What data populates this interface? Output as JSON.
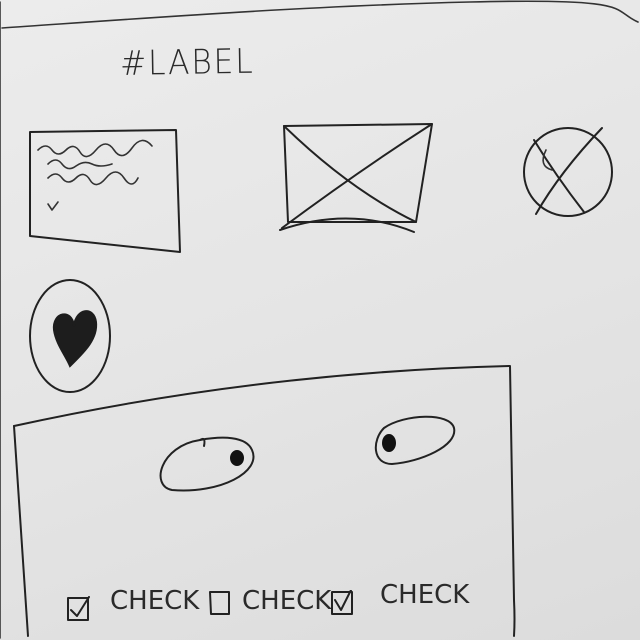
{
  "header": {
    "label": "#LABEL"
  },
  "icons": {
    "text_block": "text-paragraph-icon",
    "image_placeholder": "image-placeholder-icon",
    "close_circle": "close-circle-icon",
    "heart_button": "heart-icon"
  },
  "panel": {
    "eyes": [
      "eye-icon",
      "eye-icon"
    ]
  },
  "checkboxes": [
    {
      "label": "CHECK",
      "checked": true
    },
    {
      "label": "CHECK",
      "checked": false
    },
    {
      "label": "CHECK",
      "checked": true
    }
  ]
}
